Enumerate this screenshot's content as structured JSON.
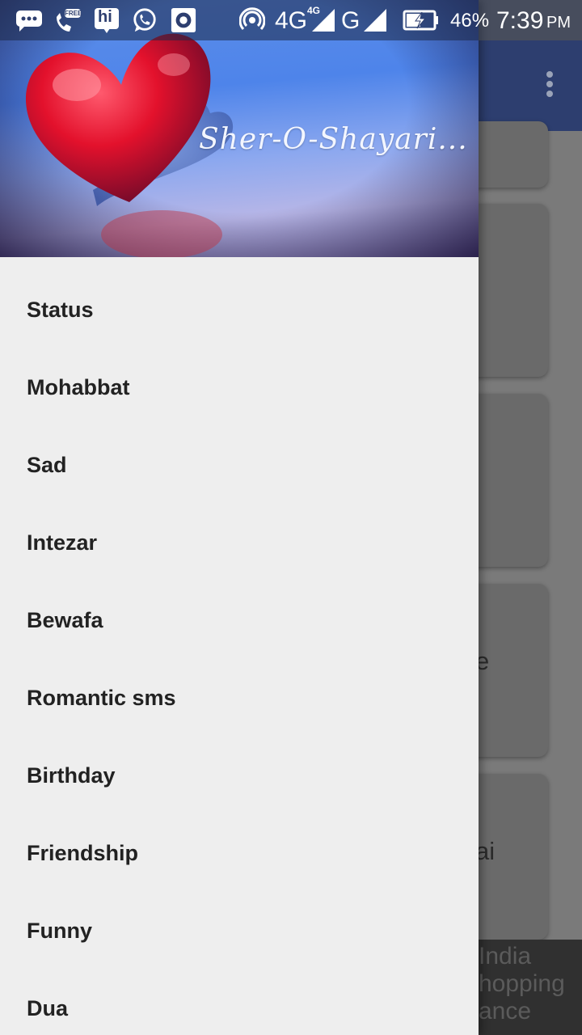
{
  "status_bar": {
    "network": "4G",
    "network_sub": "4G",
    "network2": "G",
    "battery": "46%",
    "time": "7:39",
    "ampm": "PM",
    "free_badge": "FREE",
    "hi_label": "hi"
  },
  "drawer": {
    "header_title": "Sher-O-Shayari...",
    "items": [
      {
        "label": "Status"
      },
      {
        "label": "Mohabbat"
      },
      {
        "label": "Sad"
      },
      {
        "label": "Intezar"
      },
      {
        "label": "Bewafa"
      },
      {
        "label": "Romantic sms"
      },
      {
        "label": "Birthday"
      },
      {
        "label": "Friendship"
      },
      {
        "label": "Funny"
      },
      {
        "label": "Dua"
      }
    ]
  },
  "background": {
    "card_fragments": [
      "e",
      "ai"
    ],
    "ad_lines": [
      "India",
      "hopping",
      "ance"
    ]
  },
  "colors": {
    "toolbar": "#2d3e6f",
    "drawer_bg": "#eeeeee",
    "heart": "#d8102a"
  }
}
